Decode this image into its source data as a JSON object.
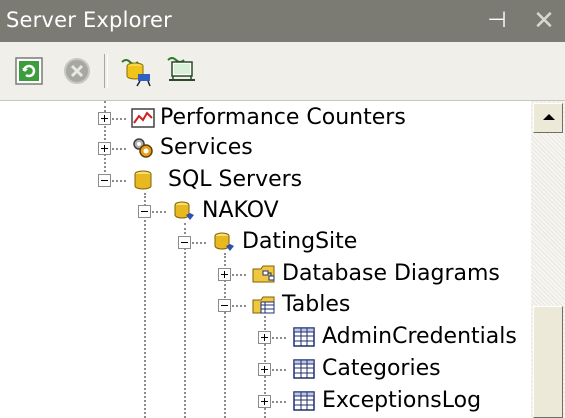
{
  "window": {
    "title": "Server Explorer",
    "pin_symbol": "⊣",
    "close_symbol": "✕"
  },
  "toolbar": {
    "buttons": [
      {
        "name": "refresh-icon"
      },
      {
        "name": "stop-icon"
      },
      {
        "name": "connect-to-database-icon"
      },
      {
        "name": "connect-to-server-icon"
      }
    ]
  },
  "tree": {
    "items": [
      {
        "label": "Performance Counters",
        "icon": "performance-counters-icon",
        "state": "collapsed"
      },
      {
        "label": "Services",
        "icon": "services-icon",
        "state": "collapsed"
      },
      {
        "label": "SQL Servers",
        "icon": "sql-servers-icon",
        "state": "expanded"
      },
      {
        "label": "NAKOV",
        "icon": "sql-server-instance-icon",
        "state": "expanded"
      },
      {
        "label": "DatingSite",
        "icon": "database-icon",
        "state": "expanded"
      },
      {
        "label": "Database Diagrams",
        "icon": "database-diagrams-icon",
        "state": "collapsed"
      },
      {
        "label": "Tables",
        "icon": "tables-folder-icon",
        "state": "expanded"
      },
      {
        "label": "AdminCredentials",
        "icon": "table-icon",
        "state": "collapsed"
      },
      {
        "label": "Categories",
        "icon": "table-icon",
        "state": "collapsed"
      },
      {
        "label": "ExceptionsLog",
        "icon": "table-icon",
        "state": "collapsed"
      }
    ]
  },
  "colors": {
    "titlebar": "#7c7b73",
    "toolbar": "#f0efe9",
    "scrollbar_track": "#f4f3ee"
  }
}
